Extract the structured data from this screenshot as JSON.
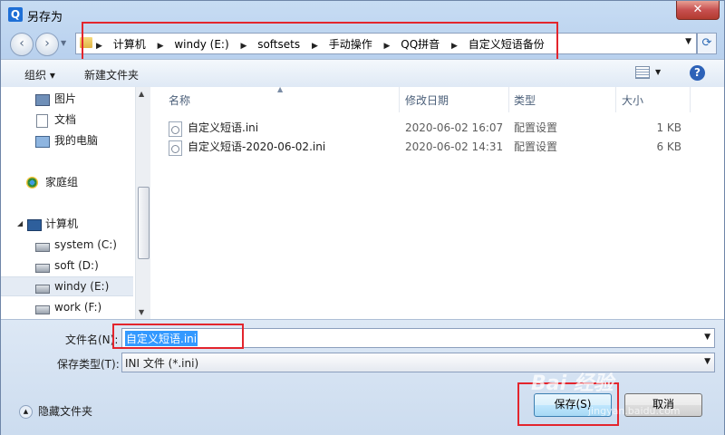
{
  "window": {
    "title": "另存为",
    "app_icon": "Q",
    "close": "✕"
  },
  "nav": {
    "back": "‹",
    "forward": "›"
  },
  "address": {
    "crumbs": [
      "计算机",
      "windy (E:)",
      "softsets",
      "手动操作",
      "QQ拼音",
      "自定义短语备份"
    ],
    "separator": "▶"
  },
  "toolbar": {
    "organize": "组织 ▾",
    "new_folder": "新建文件夹",
    "help": "?"
  },
  "sidebar": {
    "items": [
      {
        "label": "图片",
        "icon": "pictures-icon"
      },
      {
        "label": "文档",
        "icon": "documents-icon"
      },
      {
        "label": "我的电脑",
        "icon": "my-computer-icon"
      },
      {
        "label": "家庭组",
        "icon": "homegroup-icon"
      },
      {
        "label": "计算机",
        "icon": "computer-icon"
      },
      {
        "label": "system (C:)",
        "icon": "drive-icon"
      },
      {
        "label": "soft (D:)",
        "icon": "drive-icon"
      },
      {
        "label": "windy (E:)",
        "icon": "drive-icon"
      },
      {
        "label": "work (F:)",
        "icon": "drive-icon"
      }
    ]
  },
  "columns": {
    "name": "名称",
    "modified": "修改日期",
    "type": "类型",
    "size": "大小"
  },
  "files": [
    {
      "name": "自定义短语.ini",
      "modified": "2020-06-02 16:07",
      "type": "配置设置",
      "size": "1 KB"
    },
    {
      "name": "自定义短语-2020-06-02.ini",
      "modified": "2020-06-02 14:31",
      "type": "配置设置",
      "size": "6 KB"
    }
  ],
  "save": {
    "filename_label": "文件名(N):",
    "filename_value": "自定义短语.ini",
    "filetype_label": "保存类型(T):",
    "filetype_value": "INI 文件 (*.ini)",
    "hide_folders": "隐藏文件夹",
    "save_button": "保存(S)",
    "cancel_button": "取消"
  },
  "watermark": {
    "text": "Bai 经验",
    "url": "jingyan.baidu.com"
  },
  "colors": {
    "highlight": "#e3252d",
    "selection": "#3399ff"
  }
}
